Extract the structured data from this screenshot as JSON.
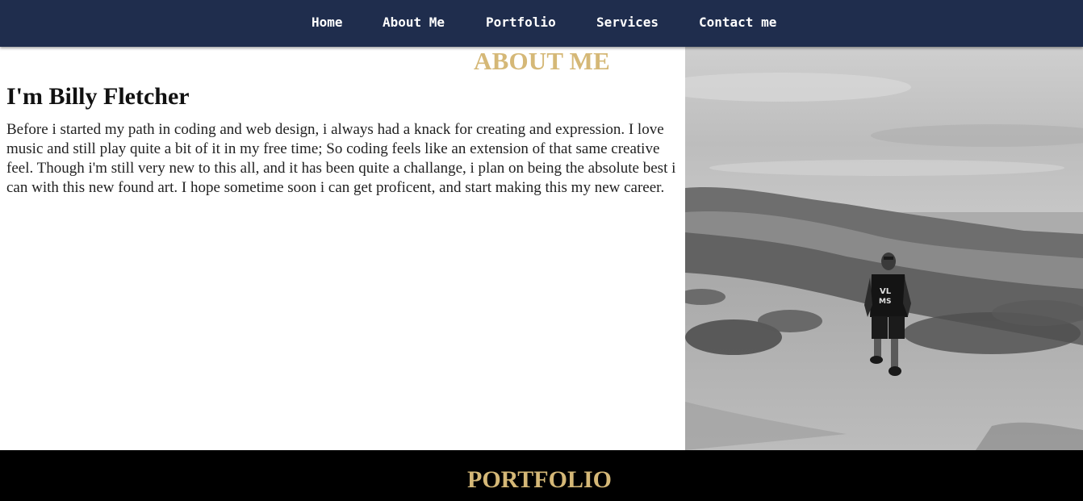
{
  "nav": {
    "items": [
      {
        "label": "Home"
      },
      {
        "label": "About Me"
      },
      {
        "label": "Portfolio"
      },
      {
        "label": "Services"
      },
      {
        "label": "Contact me"
      }
    ]
  },
  "about": {
    "heading": "ABOUT ME",
    "name": "I'm Billy Fletcher",
    "body": "Before i started my path in coding and web design, i always had a knack for creating and expression. I love music and still play quite a bit of it in my free time; So coding feels like an extension of that same creative feel. Though i'm still very new to this all, and it has been quite a challange, i plan on being the absolute best i can with this new found art. I hope sometime soon i can get proficent, and start making this my new career.",
    "photo": {
      "description_icon": "person-hiking-photo",
      "shirt_text": "VL MS"
    }
  },
  "portfolio": {
    "heading": "PORTFOLIO"
  },
  "colors": {
    "nav_bg": "#1f2d4d",
    "accent_gold": "#d5b877",
    "footer_bg": "#000000"
  }
}
